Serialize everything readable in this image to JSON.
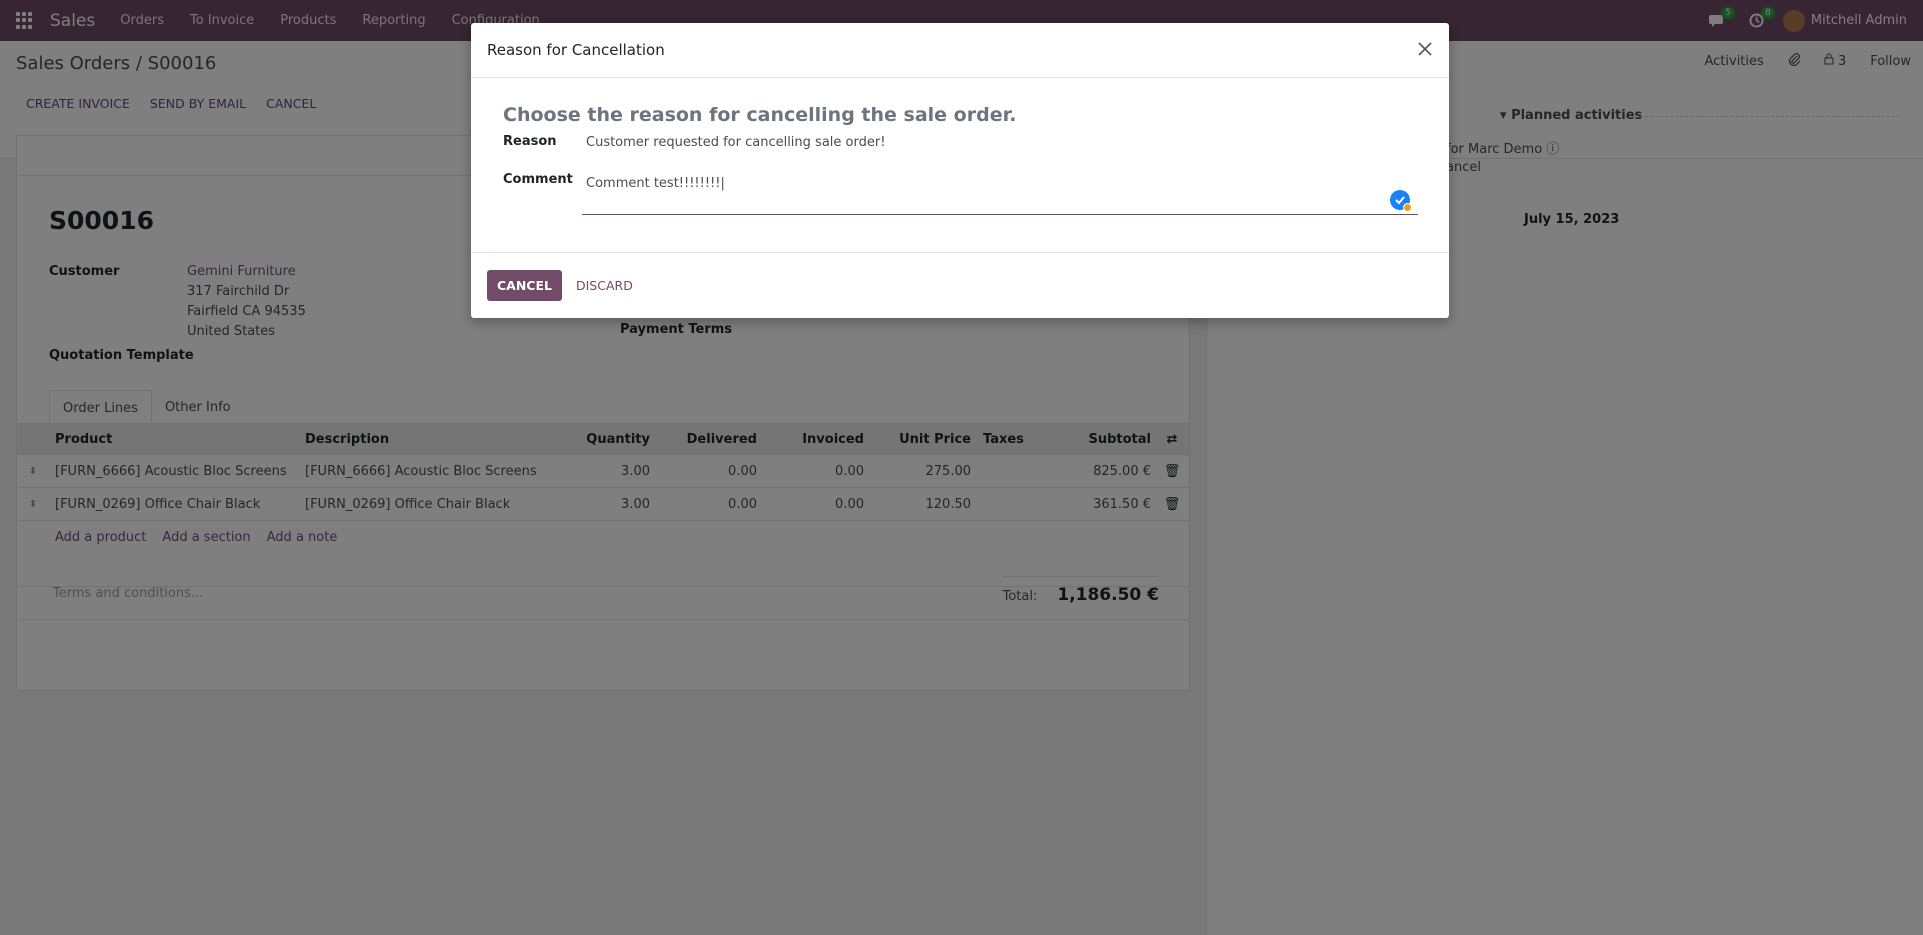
{
  "navbar": {
    "brand": "Sales",
    "menu": [
      "Orders",
      "To Invoice",
      "Products",
      "Reporting",
      "Configuration"
    ],
    "chat_badge": "5",
    "activity_badge": "8",
    "user": "Mitchell Admin"
  },
  "control": {
    "breadcrumb": "Sales Orders / S00016",
    "actions": [
      "CREATE INVOICE",
      "SEND BY EMAIL",
      "CANCEL"
    ],
    "chatter_tabs": [
      "Activities",
      "3",
      "Follow"
    ]
  },
  "form": {
    "order_name": "S00016",
    "customer_label": "Customer",
    "customer_name": "Gemini Furniture",
    "address_line1": "317 Fairchild Dr",
    "address_line2": "Fairfield CA 94535",
    "address_line3": "United States",
    "payment_terms_label": "Payment Terms",
    "quotation_template_label": "Quotation Template",
    "tabs": [
      "Order Lines",
      "Other Info"
    ],
    "columns": [
      "Product",
      "Description",
      "Quantity",
      "Delivered",
      "Invoiced",
      "Unit Price",
      "Taxes",
      "Subtotal"
    ],
    "lines": [
      {
        "product": "[FURN_6666] Acoustic Bloc Screens",
        "description": "[FURN_6666] Acoustic Bloc Screens",
        "qty": "3.00",
        "delivered": "0.00",
        "invoiced": "0.00",
        "price": "275.00",
        "taxes": "",
        "subtotal": "825.00 €"
      },
      {
        "product": "[FURN_0269] Office Chair Black",
        "description": "[FURN_0269] Office Chair Black",
        "qty": "3.00",
        "delivered": "0.00",
        "invoiced": "0.00",
        "price": "120.50",
        "taxes": "",
        "subtotal": "361.50 €"
      }
    ],
    "add_links": [
      "Add a product",
      "Add a section",
      "Add a note"
    ],
    "terms_placeholder": "Terms and conditions...",
    "total_label": "Total:",
    "total_value": "1,186.50 €"
  },
  "chatter": {
    "planned_label": "Planned activities",
    "activity": "for Marc Demo",
    "cancel_fragment": "ancel",
    "date": "July 15, 2023"
  },
  "modal": {
    "title": "Reason for Cancellation",
    "heading": "Choose the reason for cancelling the sale order.",
    "reason_label": "Reason",
    "reason_value": "Customer requested for cancelling sale order!",
    "comment_label": "Comment",
    "comment_value": "Comment test!!!!!!!!|",
    "cancel_btn": "CANCEL",
    "discard_btn": "DISCARD"
  }
}
